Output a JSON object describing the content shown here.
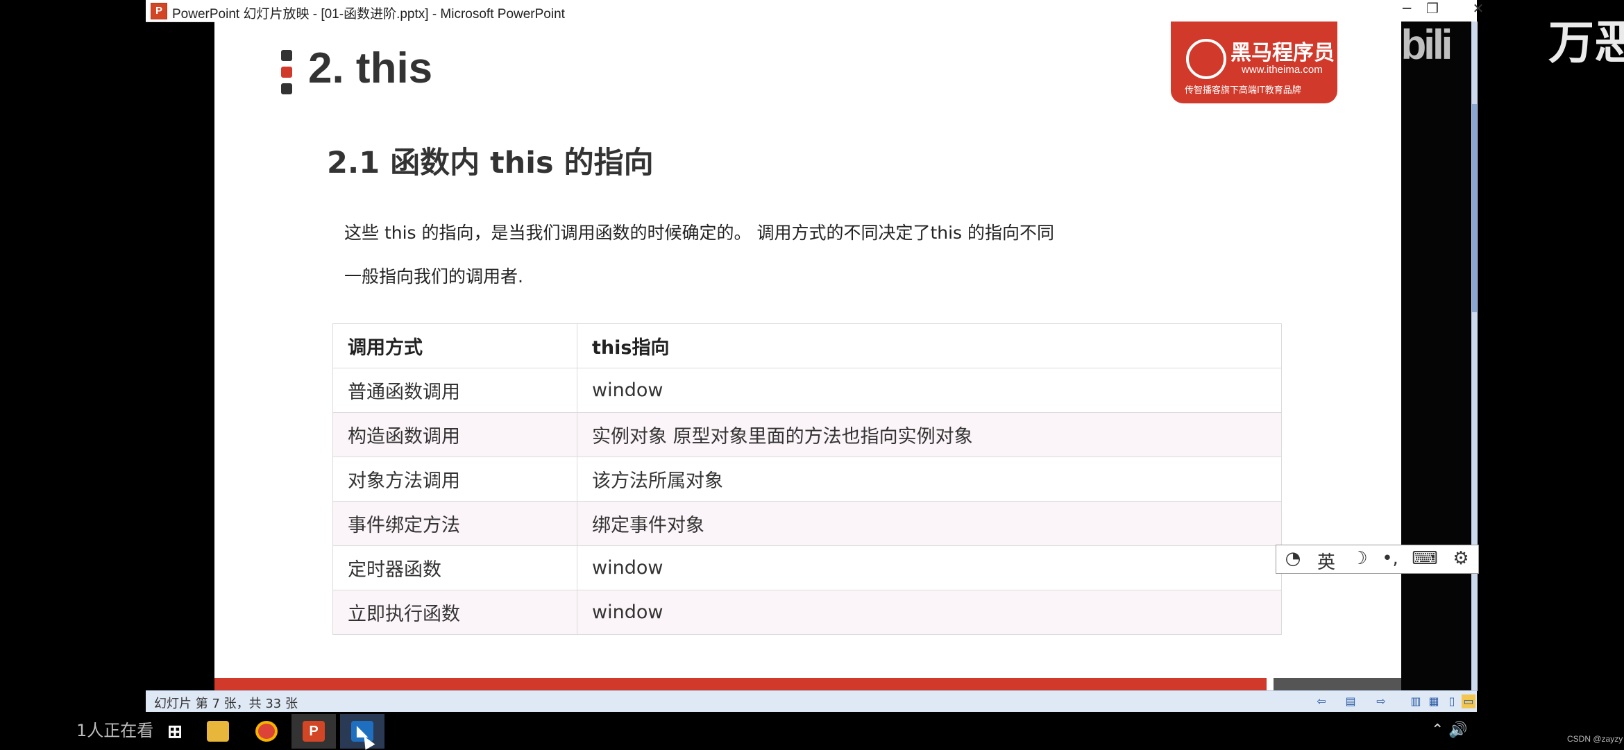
{
  "window": {
    "title": "PowerPoint 幻灯片放映 - [01-函数进阶.pptx] - Microsoft PowerPoint",
    "app_icon": "P",
    "minimize": "─",
    "restore": "❐",
    "close": "✕"
  },
  "slide": {
    "title": "2. this",
    "subtitle": "2.1 函数内 this 的指向",
    "para1": "这些 this 的指向，是当我们调用函数的时候确定的。 调用方式的不同决定了this 的指向不同",
    "para2": "一般指向我们的调用者.",
    "logo": {
      "name": "黑马程序员",
      "url": "www.itheima.com",
      "tagline": "传智播客旗下高端IT教育品牌"
    },
    "table": {
      "headers": [
        "调用方式",
        "this指向"
      ],
      "rows": [
        [
          "普通函数调用",
          "window"
        ],
        [
          "构造函数调用",
          "实例对象  原型对象里面的方法也指向实例对象"
        ],
        [
          "对象方法调用",
          "该方法所属对象"
        ],
        [
          "事件绑定方法",
          "绑定事件对象"
        ],
        [
          "定时器函数",
          "window"
        ],
        [
          "立即执行函数",
          "window"
        ]
      ]
    }
  },
  "overlay": {
    "watermark": "bilibili",
    "corner_text": "万恶"
  },
  "ime": {
    "lang": "英",
    "items": [
      "logo-icon",
      "moon-icon",
      "punctuation-icon",
      "keyboard-icon",
      "gear-icon"
    ]
  },
  "statusbar": {
    "text": "幻灯片 第 7 张，共 33 张"
  },
  "taskbar": {
    "viewers": "1人正在看",
    "csdn": "CSDN @zayzy"
  },
  "colors": {
    "accent_red": "#d1392b",
    "bullet_dark": "#333333"
  }
}
